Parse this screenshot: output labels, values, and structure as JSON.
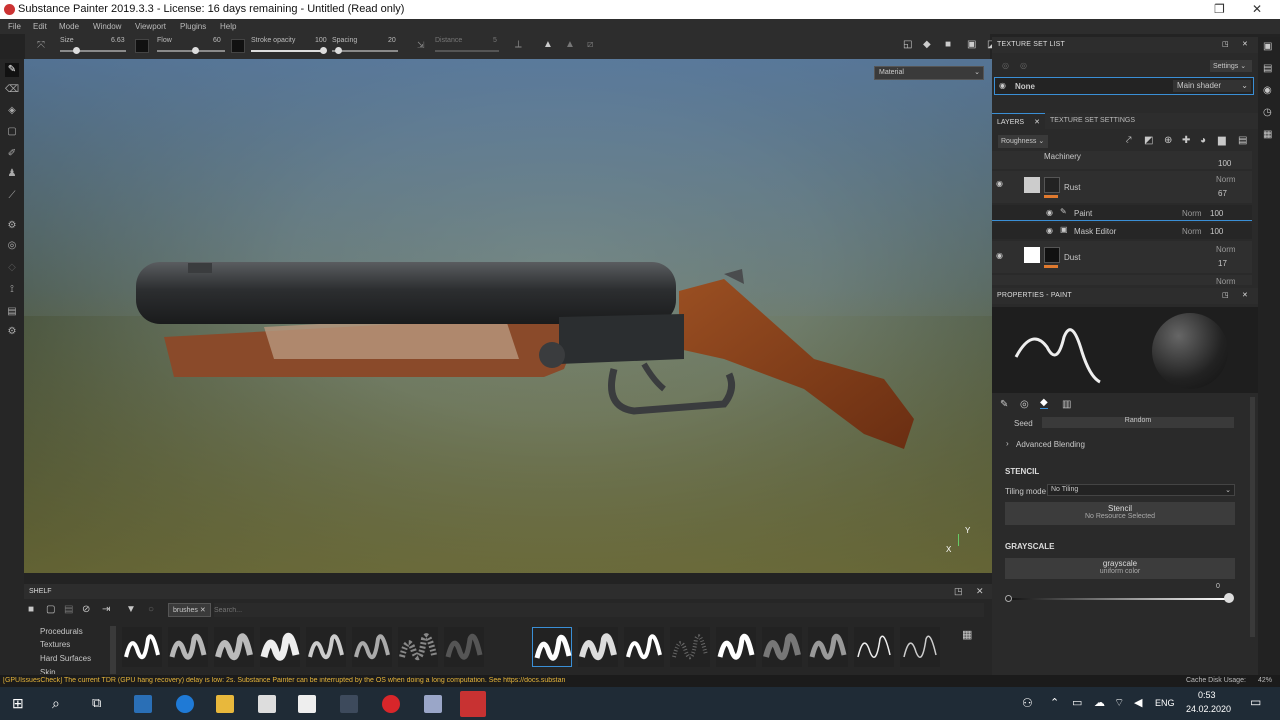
{
  "window": {
    "title": "Substance Painter 2019.3.3 - License: 16 days remaining - Untitled (Read only)"
  },
  "menu": [
    "File",
    "Edit",
    "Mode",
    "Window",
    "Viewport",
    "Plugins",
    "Help"
  ],
  "toolbar": {
    "size_label": "Size",
    "size_value": "6.63",
    "flow_label": "Flow",
    "flow_value": "60",
    "stroke_opacity_label": "Stroke opacity",
    "stroke_opacity_value": "100",
    "spacing_label": "Spacing",
    "spacing_value": "20",
    "distance_label": "Distance",
    "distance_value": "5"
  },
  "viewport": {
    "material_mode": "Material",
    "axis_x": "X",
    "axis_y": "Y"
  },
  "texture_set_list": {
    "title": "TEXTURE SET LIST",
    "settings_label": "Settings",
    "set_name": "None",
    "shader": "Main shader"
  },
  "layers": {
    "tab_layers": "LAYERS",
    "tab_tss": "TEXTURE SET SETTINGS",
    "channel": "Roughness",
    "rows": [
      {
        "name": "Machinery",
        "blend": "",
        "opacity": "100"
      },
      {
        "name": "Rust",
        "blend": "Norm",
        "opacity": "67"
      },
      {
        "name": "Paint",
        "blend": "Norm",
        "opacity": "100"
      },
      {
        "name": "Mask Editor",
        "blend": "Norm",
        "opacity": "100"
      },
      {
        "name": "Dust",
        "blend": "Norm",
        "opacity": "17"
      },
      {
        "name": "",
        "blend": "Norm",
        "opacity": ""
      }
    ]
  },
  "properties": {
    "title": "PROPERTIES - PAINT",
    "seed_label": "Seed",
    "seed_value": "Random",
    "advanced_blending": "Advanced Blending",
    "stencil_title": "STENCIL",
    "tiling_label": "Tiling mode",
    "tiling_value": "No Tiling",
    "stencil_btn": "Stencil",
    "stencil_sub": "No Resource Selected",
    "grayscale_title": "GRAYSCALE",
    "grayscale_btn": "grayscale",
    "grayscale_sub": "uniform color",
    "grayscale_value": "0"
  },
  "shelf": {
    "title": "SHELF",
    "filter_tag": "brushes",
    "search_placeholder": "Search...",
    "categories": [
      "Procedurals",
      "Textures",
      "Hard Surfaces",
      "Skin"
    ]
  },
  "status": {
    "message": "[GPUIssuesCheck] The current TDR (GPU hang recovery) delay is low: 2s. Substance Painter can be interrupted by the OS when doing a long computation. See https://docs.substan",
    "cache": "Cache Disk Usage:",
    "cache_value": "42%"
  },
  "taskbar": {
    "lang": "ENG",
    "time": "0:53",
    "date": "24.02.2020"
  },
  "colors": {
    "accent": "#3a8fd6",
    "orange": "#e07a2f"
  }
}
